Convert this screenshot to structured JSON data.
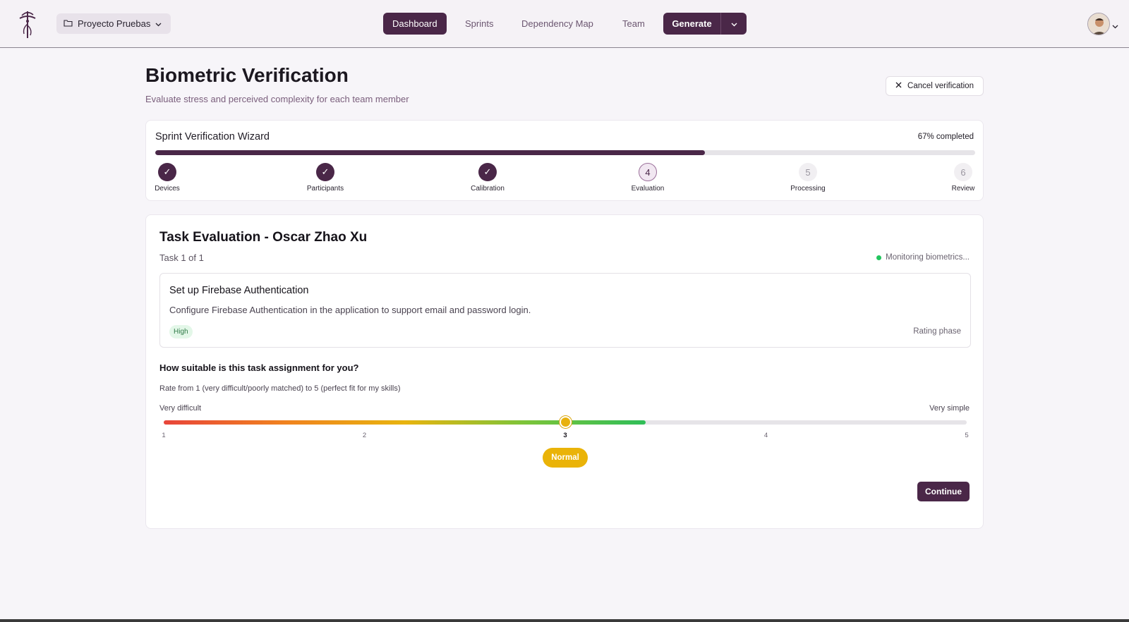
{
  "header": {
    "project_name": "Proyecto Pruebas",
    "nav": [
      {
        "label": "Dashboard",
        "active": true
      },
      {
        "label": "Sprints",
        "active": false
      },
      {
        "label": "Dependency Map",
        "active": false
      },
      {
        "label": "Team",
        "active": false
      }
    ],
    "generate_label": "Generate"
  },
  "page": {
    "title": "Biometric Verification",
    "subtitle": "Evaluate stress and perceived complexity for each team member",
    "cancel_label": "Cancel verification"
  },
  "wizard": {
    "title": "Sprint Verification Wizard",
    "progress_text": "67% completed",
    "progress_fraction": 0.67,
    "steps": [
      {
        "number": "1",
        "label": "Devices",
        "status": "done"
      },
      {
        "number": "2",
        "label": "Participants",
        "status": "done"
      },
      {
        "number": "3",
        "label": "Calibration",
        "status": "done"
      },
      {
        "number": "4",
        "label": "Evaluation",
        "status": "current"
      },
      {
        "number": "5",
        "label": "Processing",
        "status": "pending"
      },
      {
        "number": "6",
        "label": "Review",
        "status": "pending"
      }
    ]
  },
  "evaluation": {
    "heading": "Task Evaluation - Oscar Zhao Xu",
    "task_count": "Task 1 of 1",
    "monitoring": "Monitoring biometrics...",
    "task": {
      "name": "Set up Firebase Authentication",
      "description": "Configure Firebase Authentication in the application to support email and password login.",
      "priority": "High",
      "phase": "Rating phase"
    },
    "question": "How suitable is this task assignment for you?",
    "hint": "Rate from 1 (very difficult/poorly matched) to 5 (perfect fit for my skills)",
    "scale_min_label": "Very difficult",
    "scale_max_label": "Very simple",
    "ticks": [
      "1",
      "2",
      "3",
      "4",
      "5"
    ],
    "selected_value": 3,
    "value_label": "Normal",
    "continue_label": "Continue"
  },
  "colors": {
    "brand": "#4a2748",
    "selected_badge": "#eab308",
    "status_dot": "#22c55e"
  }
}
